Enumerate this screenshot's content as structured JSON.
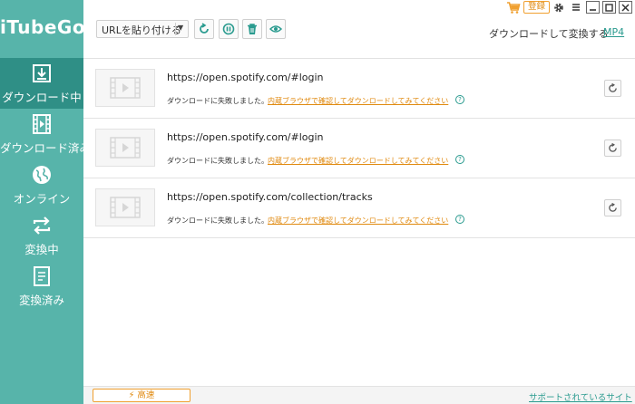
{
  "app": {
    "title": "iTubeGo"
  },
  "sidebar": {
    "items": [
      {
        "label": "ダウンロード中",
        "icon": "download-icon",
        "active": true
      },
      {
        "label": "ダウンロード済み",
        "icon": "film-icon",
        "active": false
      },
      {
        "label": "オンライン",
        "icon": "globe-icon",
        "active": false
      },
      {
        "label": "変換中",
        "icon": "convert-icon",
        "active": false
      },
      {
        "label": "変換済み",
        "icon": "document-icon",
        "active": false
      }
    ]
  },
  "toolbar": {
    "paste_url_label": "URLを貼り付ける",
    "icons": [
      "refresh-icon",
      "pause-icon",
      "trash-icon",
      "eye-icon"
    ],
    "convert_label": "ダウンロードして変換する",
    "convert_format": "MP4"
  },
  "window": {
    "register_label": "登録",
    "controls": [
      "cart-icon",
      "gear-icon",
      "menu-icon",
      "minimize-icon",
      "maximize-icon",
      "close-icon"
    ]
  },
  "downloads": [
    {
      "url": "https://open.spotify.com/#login",
      "status": "ダウンロードに失敗しました。",
      "hint_link": "内蔵ブラウザで確認してダウンロードしてみてください",
      "help": "?"
    },
    {
      "url": "https://open.spotify.com/#login",
      "status": "ダウンロードに失敗しました。",
      "hint_link": "内蔵ブラウザで確認してダウンロードしてみてください",
      "help": "?"
    },
    {
      "url": "https://open.spotify.com/collection/tracks",
      "status": "ダウンロードに失敗しました。",
      "hint_link": "内蔵ブラウザで確認してダウンロードしてみてください",
      "help": "?"
    }
  ],
  "footer": {
    "speed_label": "高速",
    "support_link": "サポートされているサイト"
  },
  "colors": {
    "sidebar": "#57b4aa",
    "sidebar_active": "#2f8f86",
    "accent": "#2a9b8f",
    "warning": "#e08a10"
  }
}
